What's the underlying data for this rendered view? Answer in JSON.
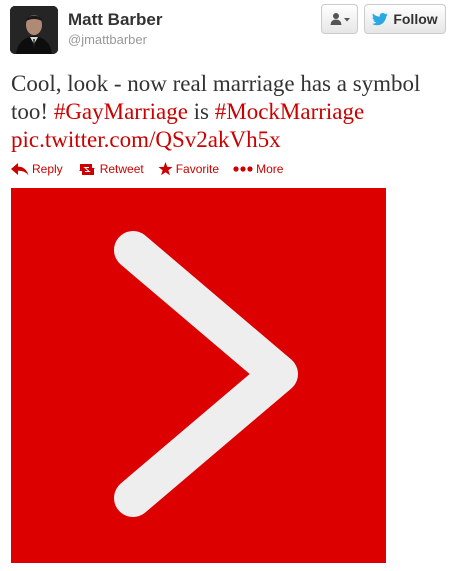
{
  "user": {
    "name": "Matt Barber",
    "handle": "@jmattbarber"
  },
  "header": {
    "follow_label": "Follow"
  },
  "tweet": {
    "text_1": "Cool, look - now real marriage has a symbol too! ",
    "hashtag_1": "#GayMarriage",
    "text_2": " is ",
    "hashtag_2": "#MockMarriage",
    "pic_link": "pic.twitter.com/QSv2akVh5x"
  },
  "actions": {
    "reply": "Reply",
    "retweet": "Retweet",
    "favorite": "Favorite",
    "more": "More"
  },
  "colors": {
    "link": "#cc0000",
    "image_background": "#dd0000",
    "image_symbol": "#eeeeee"
  },
  "icons": {
    "avatar": "avatar-photo",
    "user_dropdown": "user-dropdown-icon",
    "follow": "twitter-bird-icon",
    "reply": "reply-arrow-icon",
    "retweet": "retweet-icon",
    "favorite": "star-icon",
    "more": "more-dots-icon"
  }
}
